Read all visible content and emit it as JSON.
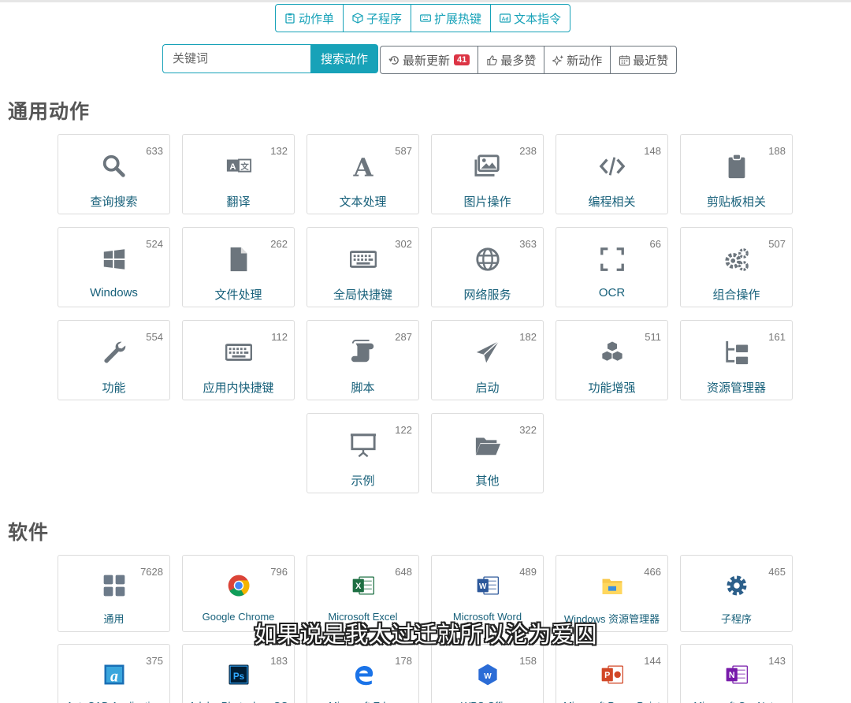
{
  "tabs": [
    {
      "label": "动作单",
      "icon": "clipboard-list-icon"
    },
    {
      "label": "子程序",
      "icon": "cube-icon"
    },
    {
      "label": "扩展热键",
      "icon": "keyboard-icon"
    },
    {
      "label": "文本指令",
      "icon": "ad-icon"
    }
  ],
  "search": {
    "placeholder": "关键词",
    "button": "搜索动作"
  },
  "sort": [
    {
      "label": "最新更新",
      "icon": "history-icon",
      "badge": "41"
    },
    {
      "label": "最多赞",
      "icon": "thumbs-up-icon"
    },
    {
      "label": "新动作",
      "icon": "sparkle-icon"
    },
    {
      "label": "最近赞",
      "icon": "calendar-icon"
    }
  ],
  "sections": {
    "general": "通用动作",
    "software": "软件"
  },
  "general_cards": [
    {
      "label": "查询搜索",
      "count": "633",
      "icon": "search-icon"
    },
    {
      "label": "翻译",
      "count": "132",
      "icon": "translate-icon"
    },
    {
      "label": "文本处理",
      "count": "587",
      "icon": "font-icon"
    },
    {
      "label": "图片操作",
      "count": "238",
      "icon": "images-icon"
    },
    {
      "label": "编程相关",
      "count": "148",
      "icon": "code-icon"
    },
    {
      "label": "剪贴板相关",
      "count": "188",
      "icon": "clipboard-icon"
    },
    {
      "label": "Windows",
      "count": "524",
      "icon": "windows-icon"
    },
    {
      "label": "文件处理",
      "count": "262",
      "icon": "file-icon"
    },
    {
      "label": "全局快捷键",
      "count": "302",
      "icon": "keyboard-icon"
    },
    {
      "label": "网络服务",
      "count": "363",
      "icon": "globe-icon"
    },
    {
      "label": "OCR",
      "count": "66",
      "icon": "expand-icon"
    },
    {
      "label": "组合操作",
      "count": "507",
      "icon": "cogs-icon"
    },
    {
      "label": "功能",
      "count": "554",
      "icon": "wrench-icon"
    },
    {
      "label": "应用内快捷键",
      "count": "112",
      "icon": "keyboard-icon"
    },
    {
      "label": "脚本",
      "count": "287",
      "icon": "scroll-icon"
    },
    {
      "label": "启动",
      "count": "182",
      "icon": "paper-plane-icon"
    },
    {
      "label": "功能增强",
      "count": "511",
      "icon": "cubes-icon"
    },
    {
      "label": "资源管理器",
      "count": "161",
      "icon": "folder-tree-icon"
    },
    {
      "label": "示例",
      "count": "122",
      "icon": "presentation-icon"
    },
    {
      "label": "其他",
      "count": "322",
      "icon": "folder-open-icon"
    }
  ],
  "software_cards": [
    {
      "label": "通用",
      "count": "7628",
      "icon": "grid-icon"
    },
    {
      "label": "Google Chrome",
      "count": "796",
      "icon": "chrome-icon"
    },
    {
      "label": "Microsoft Excel",
      "count": "648",
      "icon": "excel-icon"
    },
    {
      "label": "Microsoft Word",
      "count": "489",
      "icon": "word-icon"
    },
    {
      "label": "Windows 资源管理器",
      "count": "466",
      "icon": "explorer-icon"
    },
    {
      "label": "子程序",
      "count": "465",
      "icon": "gear-icon"
    },
    {
      "label": "AutoCAD Application",
      "count": "375",
      "icon": "autocad-icon"
    },
    {
      "label": "Adobe Photoshop CC",
      "count": "183",
      "icon": "photoshop-icon"
    },
    {
      "label": "Microsoft Edge",
      "count": "178",
      "icon": "edge-icon"
    },
    {
      "label": "WPS Office",
      "count": "158",
      "icon": "wps-icon"
    },
    {
      "label": "Microsoft PowerPoint",
      "count": "144",
      "icon": "powerpoint-icon"
    },
    {
      "label": "Microsoft OneNote",
      "count": "143",
      "icon": "onenote-icon"
    }
  ],
  "subtitle": "如果说是我太过迁就所以沦为爱囚",
  "colors": {
    "accent": "#17a2b8",
    "badge": "#dc3545",
    "icon_gray": "#6c757d",
    "label": "#17607a"
  }
}
